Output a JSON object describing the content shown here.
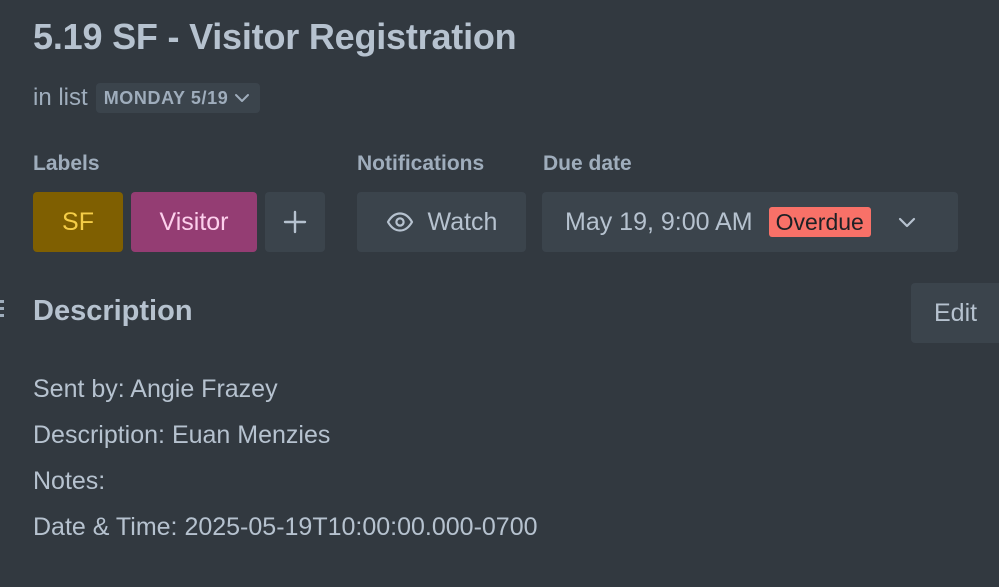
{
  "card": {
    "title": "5.19 SF - Visitor Registration",
    "in_list_prefix": "in list",
    "list_name": "MONDAY 5/19"
  },
  "labels_section": {
    "heading": "Labels",
    "labels": [
      {
        "text": "SF",
        "bg": "#7f5f01",
        "fg": "#f5cd47"
      },
      {
        "text": "Visitor",
        "bg": "#943d73",
        "fg": "#fdd0ec"
      }
    ],
    "add_icon": "plus-icon"
  },
  "notifications_section": {
    "heading": "Notifications",
    "watch_label": "Watch",
    "watch_icon": "eye-icon"
  },
  "due_date_section": {
    "heading": "Due date",
    "value": "May 19, 9:00 AM",
    "status": "Overdue",
    "status_color": "#f87168",
    "chevron_icon": "chevron-down-icon"
  },
  "description": {
    "heading": "Description",
    "edit_label": "Edit",
    "lines": [
      "Sent by: Angie Frazey",
      "Description: Euan Menzies",
      "Notes:",
      "Date & Time: 2025-05-19T10:00:00.000-0700"
    ]
  },
  "colors": {
    "background": "#323940",
    "surface": "#3b444c",
    "text": "#b6c2cf",
    "muted_text": "#9fadbc"
  }
}
